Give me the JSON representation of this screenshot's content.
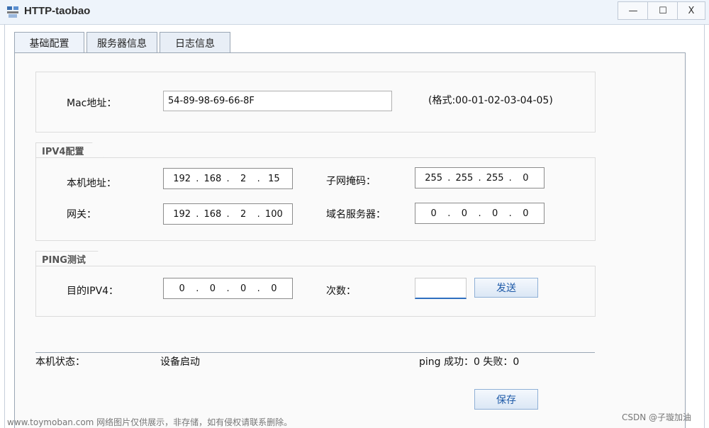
{
  "window": {
    "title": "HTTP-taobao",
    "controls": {
      "minimize": "—",
      "maximize": "☐",
      "close": "X"
    }
  },
  "tabs": [
    "基础配置",
    "服务器信息",
    "日志信息"
  ],
  "mac": {
    "label": "Mac地址：",
    "value": "54-89-98-69-66-8F",
    "format_hint": "(格式:00-01-02-03-04-05)"
  },
  "ipv4": {
    "group_title": "IPV4配置",
    "local_address": {
      "label": "本机地址：",
      "octets": [
        "192",
        "168",
        "2",
        "15"
      ]
    },
    "gateway": {
      "label": "网关：",
      "octets": [
        "192",
        "168",
        "2",
        "100"
      ]
    },
    "subnet_mask": {
      "label": "子网掩码：",
      "octets": [
        "255",
        "255",
        "255",
        "0"
      ]
    },
    "dns_server": {
      "label": "域名服务器：",
      "octets": [
        "0",
        "0",
        "0",
        "0"
      ]
    }
  },
  "ping": {
    "group_title": "PING测试",
    "target": {
      "label": "目的IPV4：",
      "octets": [
        "0",
        "0",
        "0",
        "0"
      ]
    },
    "count": {
      "label": "次数：",
      "value": ""
    },
    "send_button": "发送"
  },
  "status": {
    "label": "本机状态：",
    "value": "设备启动",
    "ping_result": "ping 成功：0 失败：0"
  },
  "save_button": "保存",
  "watermarks": {
    "left": "www.toymoban.com 网络图片仅供展示，非存储，如有侵权请联系删除。",
    "right": "CSDN @子璇加油"
  },
  "colors": {
    "titlebar_bg": "#eef4fb",
    "button_text": "#1e5aa8",
    "input_focus_underline": "#2f6fc0"
  },
  "icons": {
    "app": "app-logo-icon"
  }
}
